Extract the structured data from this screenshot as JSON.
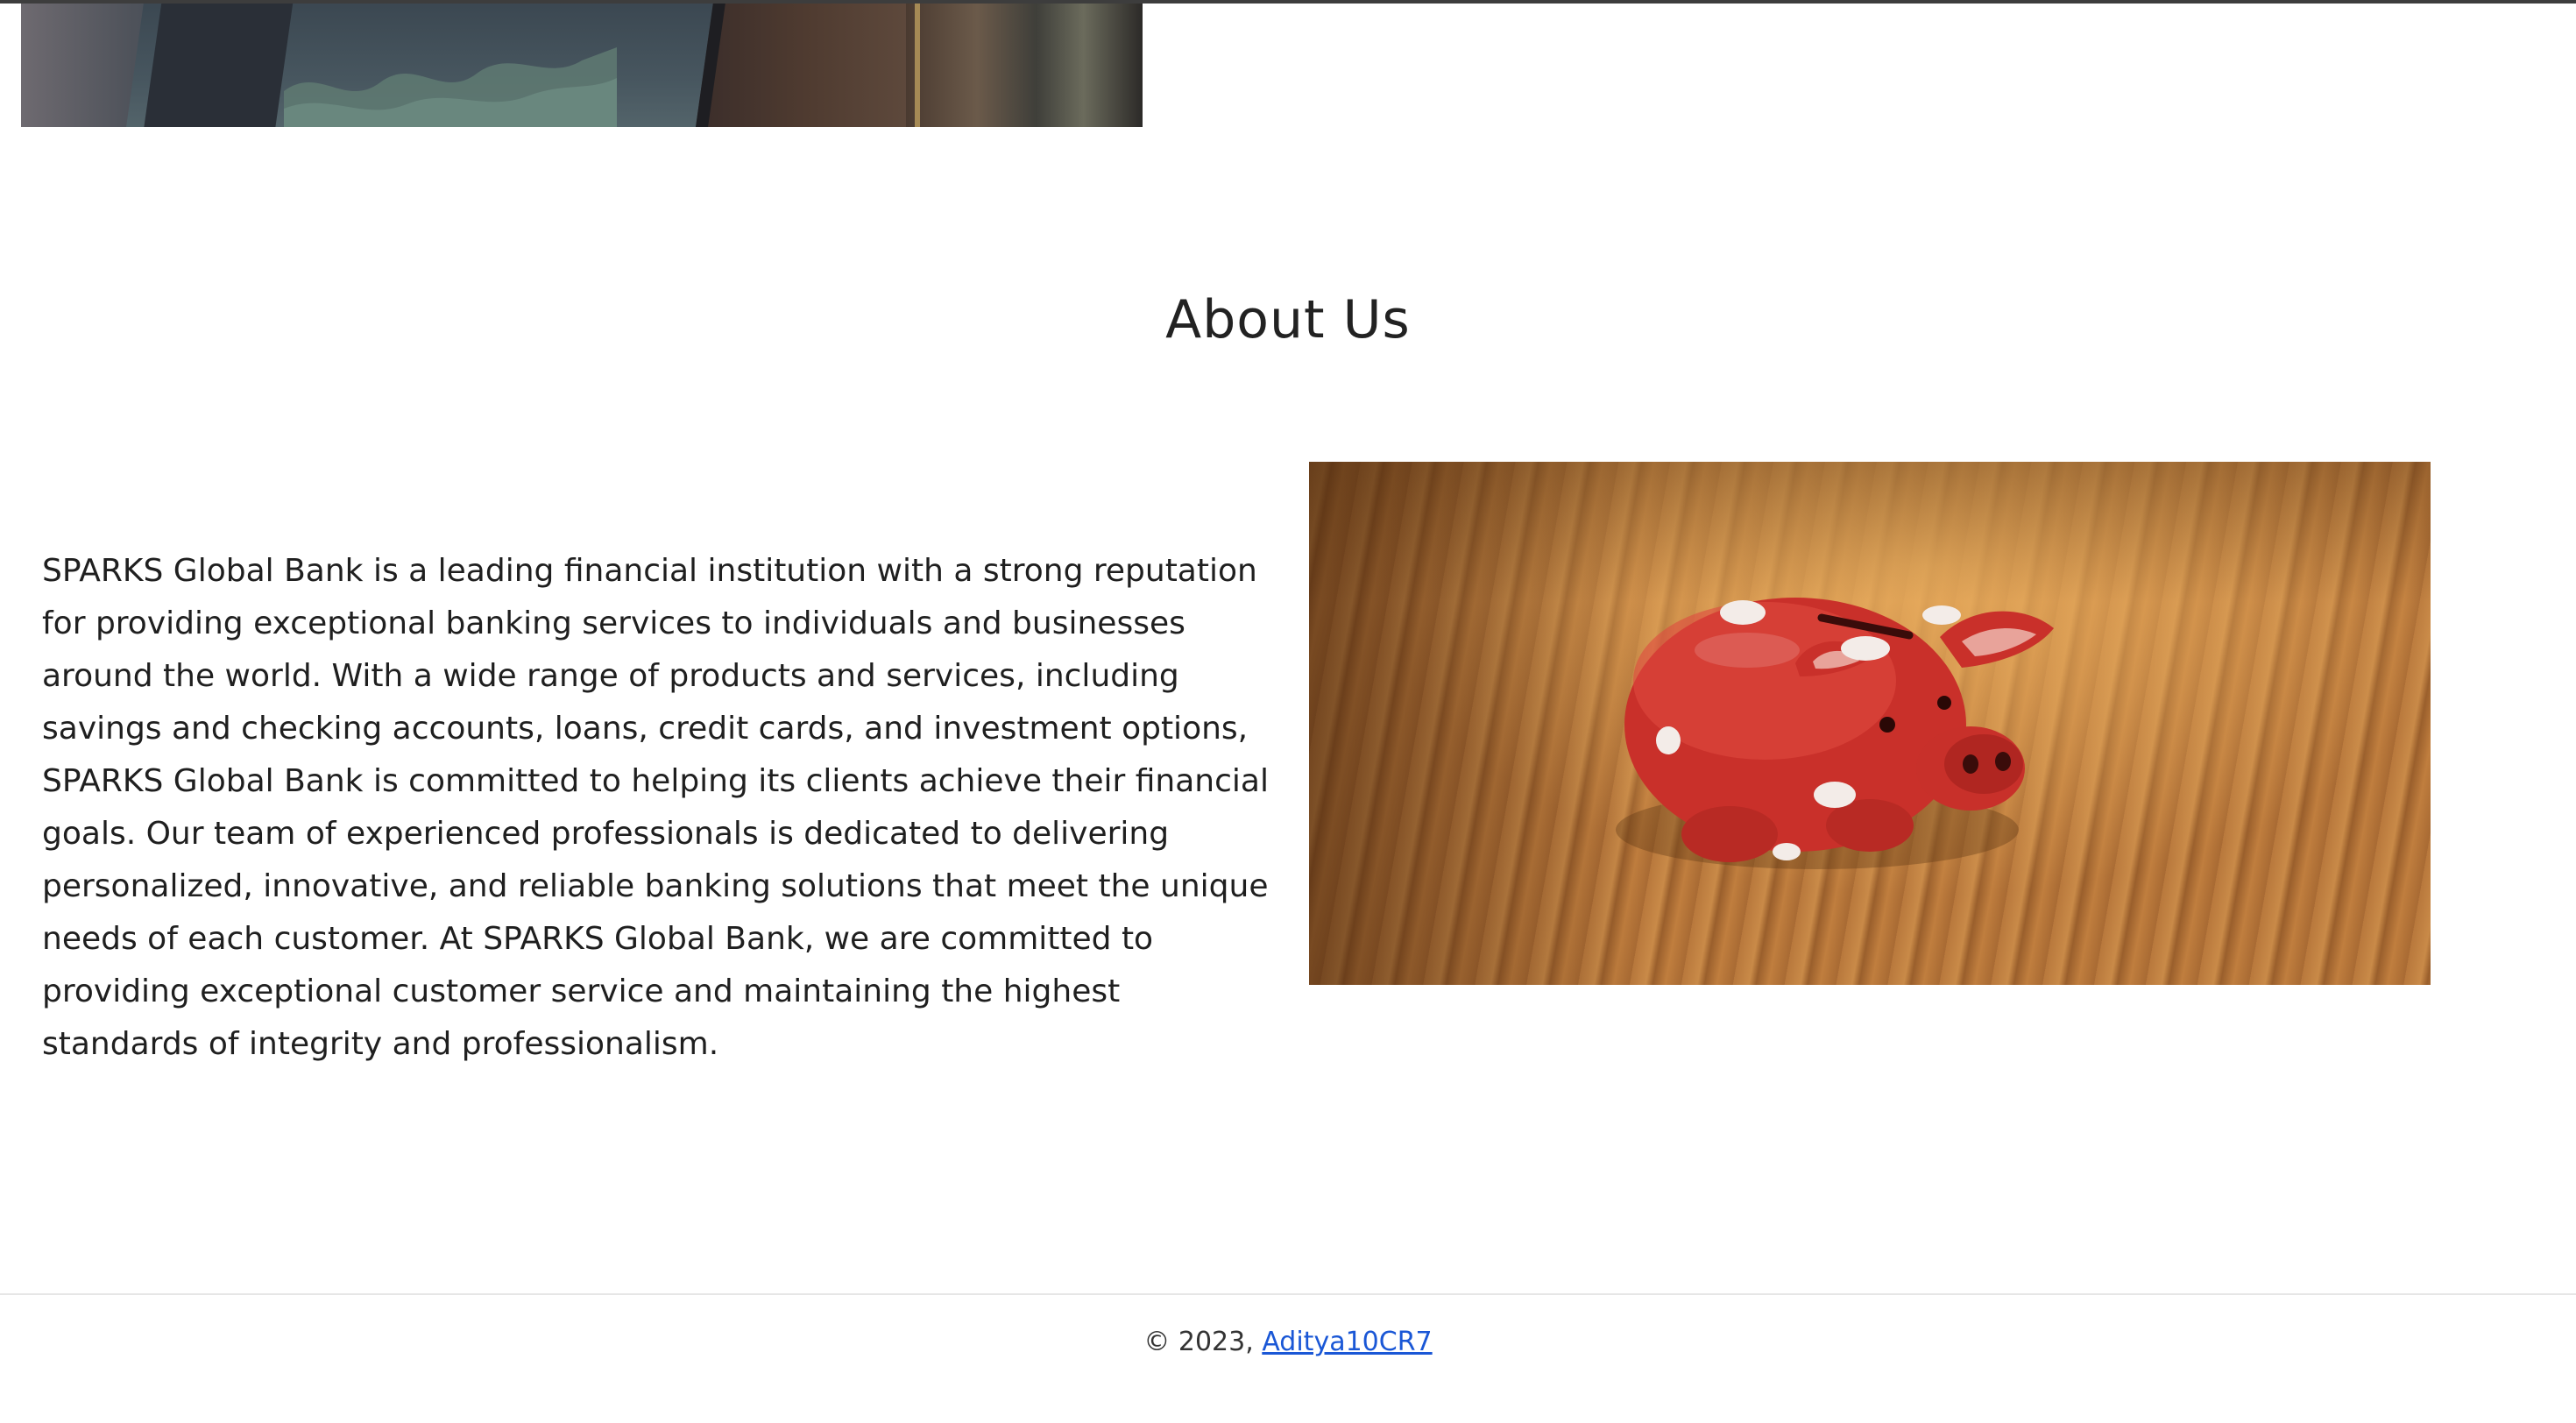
{
  "about": {
    "title": "About Us",
    "paragraph": "SPARKS Global Bank is a leading financial institution with a strong reputation for providing exceptional banking services to individuals and businesses around the world. With a wide range of products and services, including savings and checking accounts, loans, credit cards, and investment options, SPARKS Global Bank is committed to helping its clients achieve their financial goals. Our team of experienced professionals is dedicated to delivering personalized, innovative, and reliable banking solutions that meet the unique needs of each customer. At SPARKS Global Bank, we are committed to providing exceptional customer service and maintaining the highest standards of integrity and professionalism."
  },
  "footer": {
    "copyright": "© 2023, ",
    "author_link": "Aditya10CR7"
  },
  "colors": {
    "link": "#1a57d6",
    "text": "#1f1f1f",
    "divider": "#e6e6e6"
  }
}
